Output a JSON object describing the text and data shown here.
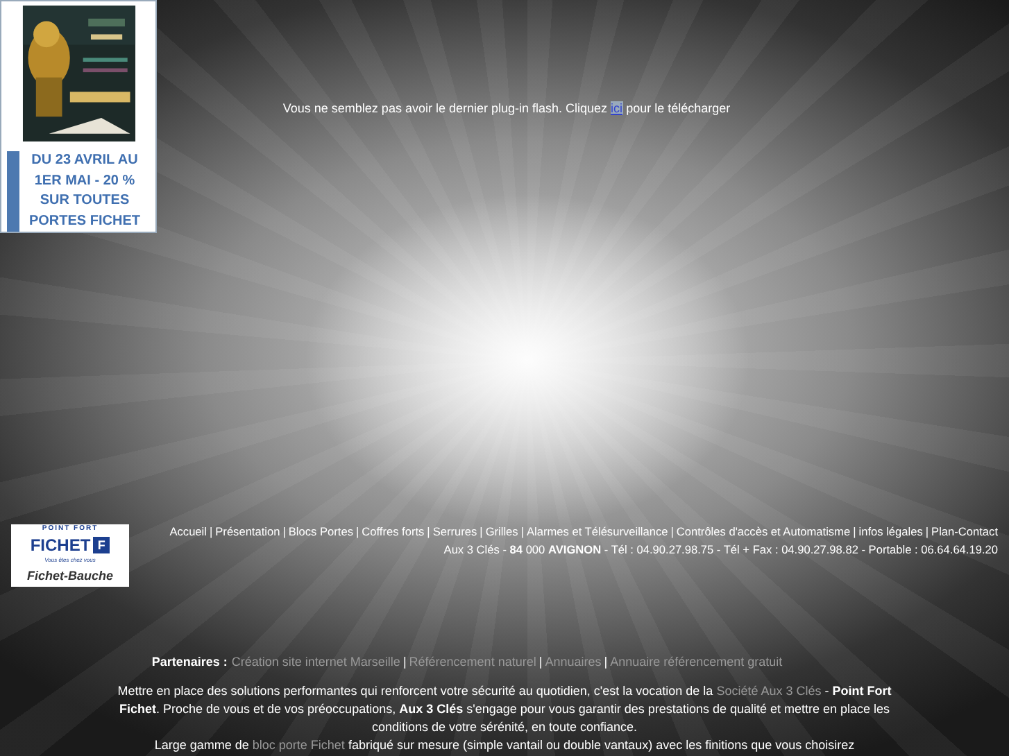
{
  "promo": {
    "text": "DU 23 AVRIL AU 1ER MAI - 20 % SUR TOUTES PORTES FICHET"
  },
  "flash_notice": {
    "before": "Vous ne semblez pas avoir le dernier plug-in flash. Cliquez",
    "link": "ici",
    "after": "pour le télécharger"
  },
  "separator": "|",
  "nav": [
    "Accueil",
    "Présentation",
    "Blocs Portes",
    "Coffres forts",
    "Serrures",
    "Grilles",
    "Alarmes et Télésurveillance",
    "Contrôles d'accès et Automatisme",
    "infos légales",
    "Plan-Contact"
  ],
  "address": "Aux 3 Clés - **84** 000 **AVIGNON** - Tél : 04.90.27.98.75 - Tél + Fax : 04.90.27.98.82 - Portable : 06.64.64.19.20",
  "logo": {
    "top": "POINT FORT",
    "brand": "FICHET",
    "tagline": "Vous êtes chez vous",
    "mark": "F",
    "bottom": "Fichet-Bauche"
  },
  "partners": {
    "label": "Partenaires :",
    "links": [
      "Création site internet Marseille",
      "Référencement naturel",
      "Annuaires",
      "Annuaire référencement gratuit"
    ]
  },
  "paragraph": [
    {
      "kind": "text",
      "text": "Mettre en place des solutions performantes qui renforcent votre sécurité au quotidien, c'est la vocation de la"
    },
    {
      "kind": "link",
      "text": "Société Aux 3 Clés"
    },
    {
      "kind": "text",
      "text": "- **Point Fort Fichet**. Proche de vous et de vos préoccupations, **Aux 3 Clés** s'engage pour vous garantir des prestations de qualité et mettre en place les conditions de votre sérénité, en toute confiance."
    },
    {
      "kind": "break"
    },
    {
      "kind": "text",
      "text": "Large gamme de"
    },
    {
      "kind": "link",
      "text": "bloc porte Fichet"
    },
    {
      "kind": "text",
      "text": "fabriqué sur mesure (simple vantail ou double vantaux) avec les finitions que vous choisirez"
    }
  ]
}
